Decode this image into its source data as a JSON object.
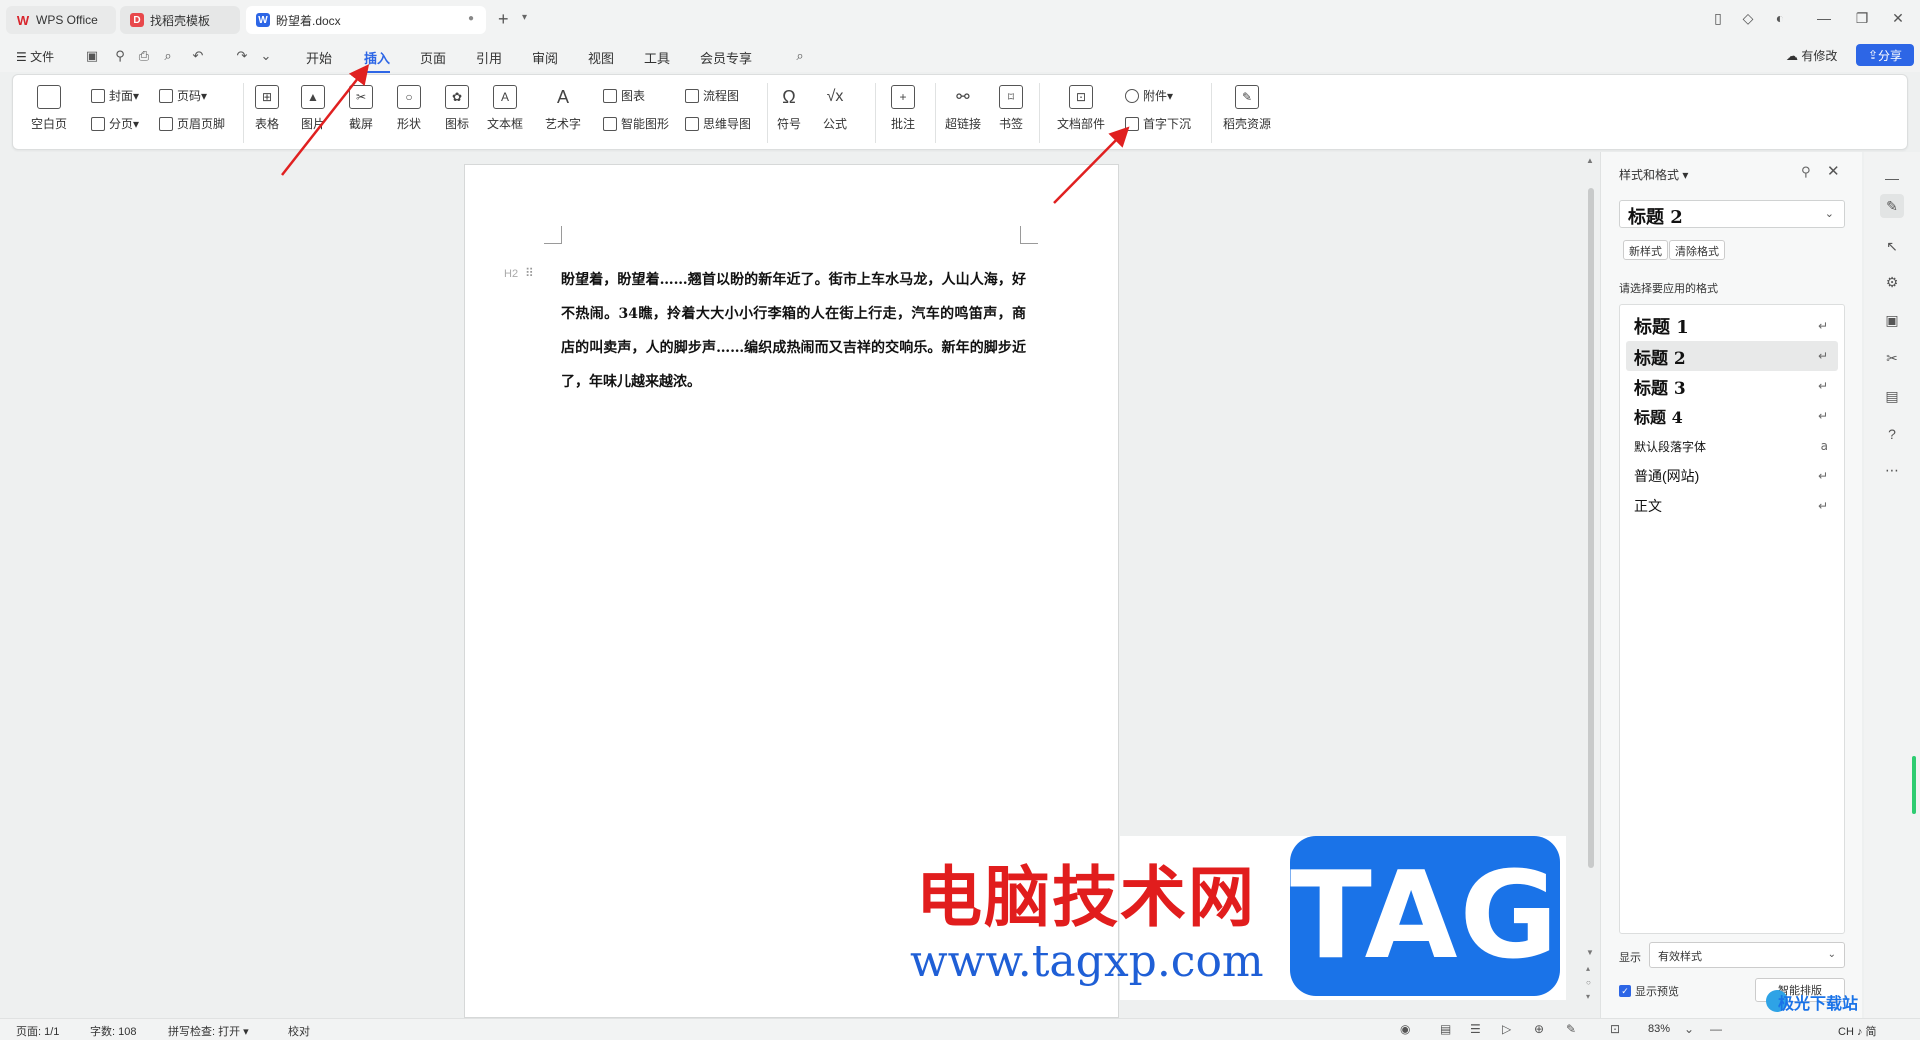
{
  "tabs": [
    {
      "label": "WPS Office"
    },
    {
      "label": "找稻壳模板"
    },
    {
      "label": "盼望着.docx"
    }
  ],
  "menu": {
    "file": "文件",
    "items": [
      "开始",
      "插入",
      "页面",
      "引用",
      "审阅",
      "视图",
      "工具",
      "会员专享"
    ],
    "active": "插入",
    "has_edit": "有修改",
    "share": "分享"
  },
  "ribbon": {
    "blank_page": "空白页",
    "cover": "封面",
    "page_break": "分页",
    "page_num": "页码",
    "header_footer": "页眉页脚",
    "table": "表格",
    "picture": "图片",
    "screenshot": "截屏",
    "shape": "形状",
    "icon": "图标",
    "textbox": "文本框",
    "art_text": "艺术字",
    "chart": "图表",
    "smart_graphic": "智能图形",
    "flowchart": "流程图",
    "mindmap": "思维导图",
    "symbol": "符号",
    "formula": "公式",
    "comment": "批注",
    "hyperlink": "超链接",
    "bookmark": "书签",
    "doc_parts": "文档部件",
    "attachment": "附件",
    "drop_cap": "首字下沉",
    "docer_resources": "稻壳资源"
  },
  "document": {
    "heading_marker": "H2",
    "paragraph": "盼望着，盼望着……翘首以盼的新年近了。街市上车水马龙，人山人海，好不热闹。34瞧，拎着大大小小行李箱的人在街上行走，汽车的鸣笛声，商店的叫卖声，人的脚步声……编织成热闹而又吉祥的交响乐。新年的脚步近了，年味儿越来越浓。"
  },
  "style_pane": {
    "title": "样式和格式",
    "current_style": "标题  2",
    "new_style": "新样式",
    "clear_format": "清除格式",
    "hint": "请选择要应用的格式",
    "styles": [
      {
        "label": "标题  1"
      },
      {
        "label": "标题  2"
      },
      {
        "label": "标题  3"
      },
      {
        "label": "标题  4"
      },
      {
        "label": "默认段落字体"
      },
      {
        "label": "普通(网站)"
      },
      {
        "label": "正文"
      }
    ],
    "selected_index": 1,
    "show_label": "显示",
    "show_value": "有效样式",
    "show_preview": "显示预览",
    "smart_layout": "智能排版"
  },
  "status": {
    "page": "页面: 1/1",
    "words": "字数: 108",
    "spell_check": "拼写检查: 打开",
    "proof": "校对",
    "zoom": "83%",
    "ime": "CH ♪ 简"
  },
  "watermark": {
    "cn": "电脑技术网",
    "url": "www.tagxp.com",
    "tag": "TAG",
    "site": "极光下载站"
  },
  "colors": {
    "accent": "#2d66e6",
    "annotation": "#e02020"
  }
}
